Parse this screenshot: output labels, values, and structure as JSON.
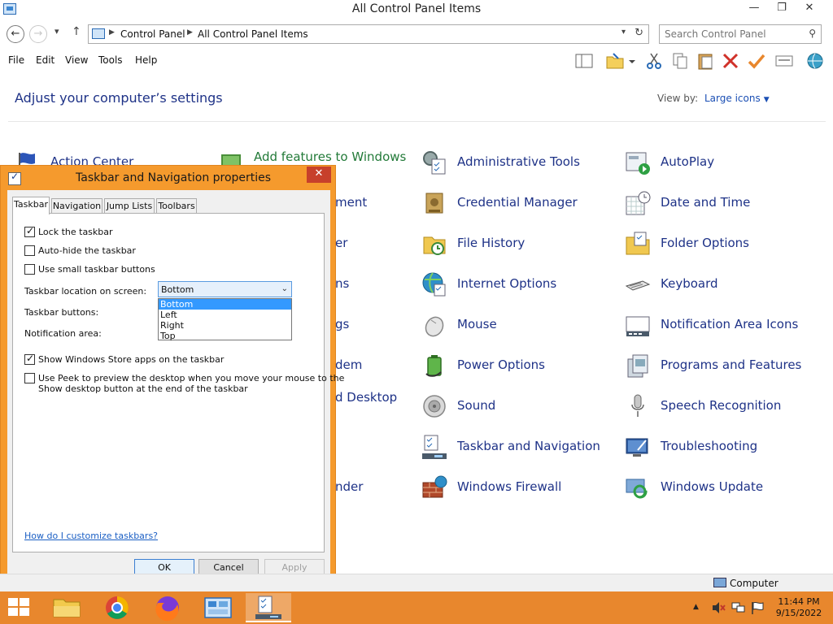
{
  "window": {
    "title": "All Control Panel Items",
    "minimize": "—",
    "restore": "❐",
    "close": "✕"
  },
  "address": {
    "back": "←",
    "forward": "→",
    "up": "↑",
    "recent": "▾",
    "crumbs": [
      "Control Panel",
      "All Control Panel Items"
    ],
    "sep": "▶",
    "dropdown": "▾",
    "refresh": "↻",
    "search_placeholder": "Search Control Panel",
    "search_glyph": "⚲"
  },
  "menu": [
    "File",
    "Edit",
    "View",
    "Tools",
    "Help"
  ],
  "content": {
    "heading": "Adjust your computer’s settings",
    "view_by_label": "View by:",
    "view_by_value": "Large icons",
    "view_by_arrow": "▼",
    "items": [
      {
        "label": "Action Center",
        "icon": "flag-icon"
      },
      {
        "label": "Add features to Windows",
        "icon": "features-icon"
      },
      {
        "label": "Administrative Tools",
        "icon": "admin-tools-icon"
      },
      {
        "label": "AutoPlay",
        "icon": "autoplay-icon"
      },
      {
        "label": "ment",
        "icon": "none"
      },
      {
        "label": "Credential Manager",
        "icon": "credential-icon"
      },
      {
        "label": "Date and Time",
        "icon": "calendar-clock-icon"
      },
      {
        "label": "er",
        "icon": "none"
      },
      {
        "label": "File History",
        "icon": "file-history-icon"
      },
      {
        "label": "Folder Options",
        "icon": "folder-options-icon"
      },
      {
        "label": "ns",
        "icon": "none"
      },
      {
        "label": "Internet Options",
        "icon": "globe-icon"
      },
      {
        "label": "Keyboard",
        "icon": "keyboard-icon"
      },
      {
        "label": "gs",
        "icon": "none"
      },
      {
        "label": "Mouse",
        "icon": "mouse-icon"
      },
      {
        "label": "Notification Area Icons",
        "icon": "notification-icon"
      },
      {
        "label": "dem",
        "icon": "none"
      },
      {
        "label": "Power Options",
        "icon": "battery-icon"
      },
      {
        "label": "Programs and Features",
        "icon": "programs-icon"
      },
      {
        "label": "d Desktop",
        "icon": "none"
      },
      {
        "label": "Sound",
        "icon": "speaker-icon"
      },
      {
        "label": "Speech Recognition",
        "icon": "microphone-icon"
      },
      {
        "label": "Taskbar and Navigation",
        "icon": "taskbar-icon"
      },
      {
        "label": "Troubleshooting",
        "icon": "troubleshoot-icon"
      },
      {
        "label": "nder",
        "icon": "none"
      },
      {
        "label": "Windows Firewall",
        "icon": "firewall-icon"
      },
      {
        "label": "Windows Update",
        "icon": "update-icon"
      }
    ]
  },
  "dialog": {
    "title": "Taskbar and Navigation properties",
    "close": "✕",
    "tabs": [
      "Taskbar",
      "Navigation",
      "Jump Lists",
      "Toolbars"
    ],
    "lock_taskbar": "Lock the taskbar",
    "lock_taskbar_checked": true,
    "auto_hide": "Auto-hide the taskbar",
    "auto_hide_checked": false,
    "small_buttons": "Use small taskbar buttons",
    "small_buttons_checked": false,
    "location_label": "Taskbar location on screen:",
    "location_value": "Bottom",
    "location_arrow": "⌄",
    "location_options": [
      "Bottom",
      "Left",
      "Right",
      "Top"
    ],
    "buttons_label": "Taskbar buttons:",
    "notification_label": "Notification area:",
    "store_apps": "Show Windows Store apps on the taskbar",
    "store_apps_checked": true,
    "peek_line1": "Use Peek to preview the desktop when you move your mouse to the",
    "peek_line2": "Show desktop button at the end of the taskbar",
    "peek_checked": false,
    "help_link": "How do I customize taskbars?",
    "ok": "OK",
    "cancel": "Cancel",
    "apply": "Apply"
  },
  "status": {
    "location": "Computer"
  },
  "taskbar": {
    "tray_show_hidden": "▲",
    "time": "11:44 PM",
    "date": "9/15/2022"
  }
}
